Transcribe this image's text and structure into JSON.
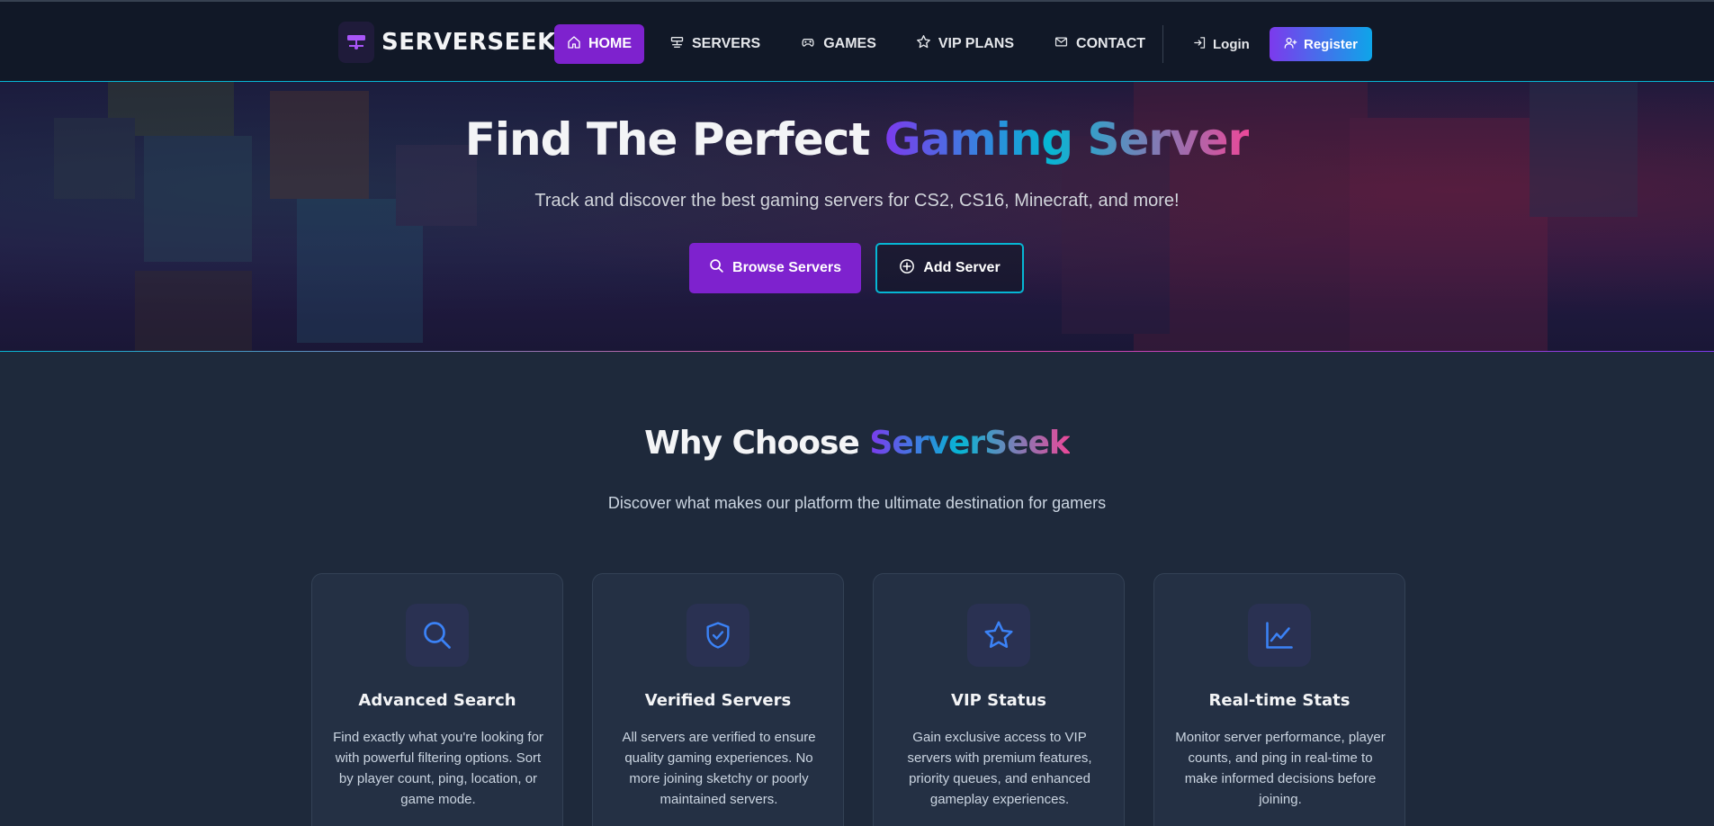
{
  "brand": {
    "name": "SERVERSEEK"
  },
  "nav": {
    "items": [
      {
        "label": "HOME",
        "icon": "home-icon",
        "active": true
      },
      {
        "label": "SERVERS",
        "icon": "servers-icon",
        "active": false
      },
      {
        "label": "GAMES",
        "icon": "gamepad-icon",
        "active": false
      },
      {
        "label": "VIP PLANS",
        "icon": "star-icon",
        "active": false
      },
      {
        "label": "CONTACT",
        "icon": "envelope-icon",
        "active": false
      }
    ],
    "login_label": "Login",
    "register_label": "Register"
  },
  "hero": {
    "title_prefix": "Find The Perfect",
    "title_highlight": "Gaming Server",
    "subtitle": "Track and discover the best gaming servers for CS2, CS16, Minecraft, and more!",
    "browse_label": "Browse Servers",
    "add_label": "Add Server"
  },
  "features": {
    "title_prefix": "Why Choose",
    "title_highlight": "ServerSeek",
    "subtitle": "Discover what makes our platform the ultimate destination for gamers",
    "cards": [
      {
        "icon": "search-icon",
        "title": "Advanced Search",
        "desc": "Find exactly what you're looking for with powerful filtering options. Sort by player count, ping, location, or game mode."
      },
      {
        "icon": "shield-check-icon",
        "title": "Verified Servers",
        "desc": "All servers are verified to ensure quality gaming experiences. No more joining sketchy or poorly maintained servers."
      },
      {
        "icon": "star-icon",
        "title": "VIP Status",
        "desc": "Gain exclusive access to VIP servers with premium features, priority queues, and enhanced gameplay experiences."
      },
      {
        "icon": "chart-line-icon",
        "title": "Real-time Stats",
        "desc": "Monitor server performance, player counts, and ping in real-time to make informed decisions before joining."
      }
    ]
  },
  "colors": {
    "accent_purple": "#7e22ce",
    "accent_cyan": "#06b6d4",
    "accent_pink": "#ec4899",
    "background": "#1e293b",
    "navbar": "#111827"
  }
}
